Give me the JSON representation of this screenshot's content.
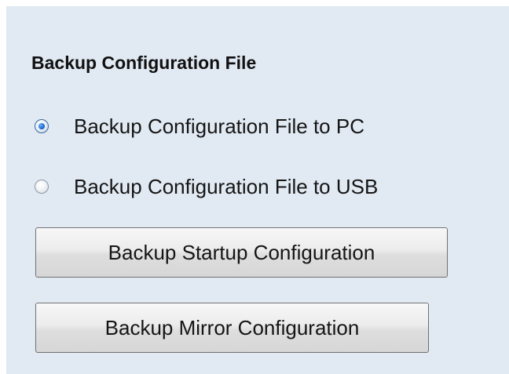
{
  "section": {
    "title": "Backup Configuration File"
  },
  "destination_options": [
    {
      "label": "Backup Configuration File to PC",
      "checked": true
    },
    {
      "label": "Backup Configuration File to USB",
      "checked": false
    }
  ],
  "buttons": {
    "startup_label": "Backup Startup Configuration",
    "mirror_label": "Backup Mirror Configuration"
  },
  "colors": {
    "panel_background": "#e1e9f3",
    "radio_selected": "#1f6fd1"
  }
}
